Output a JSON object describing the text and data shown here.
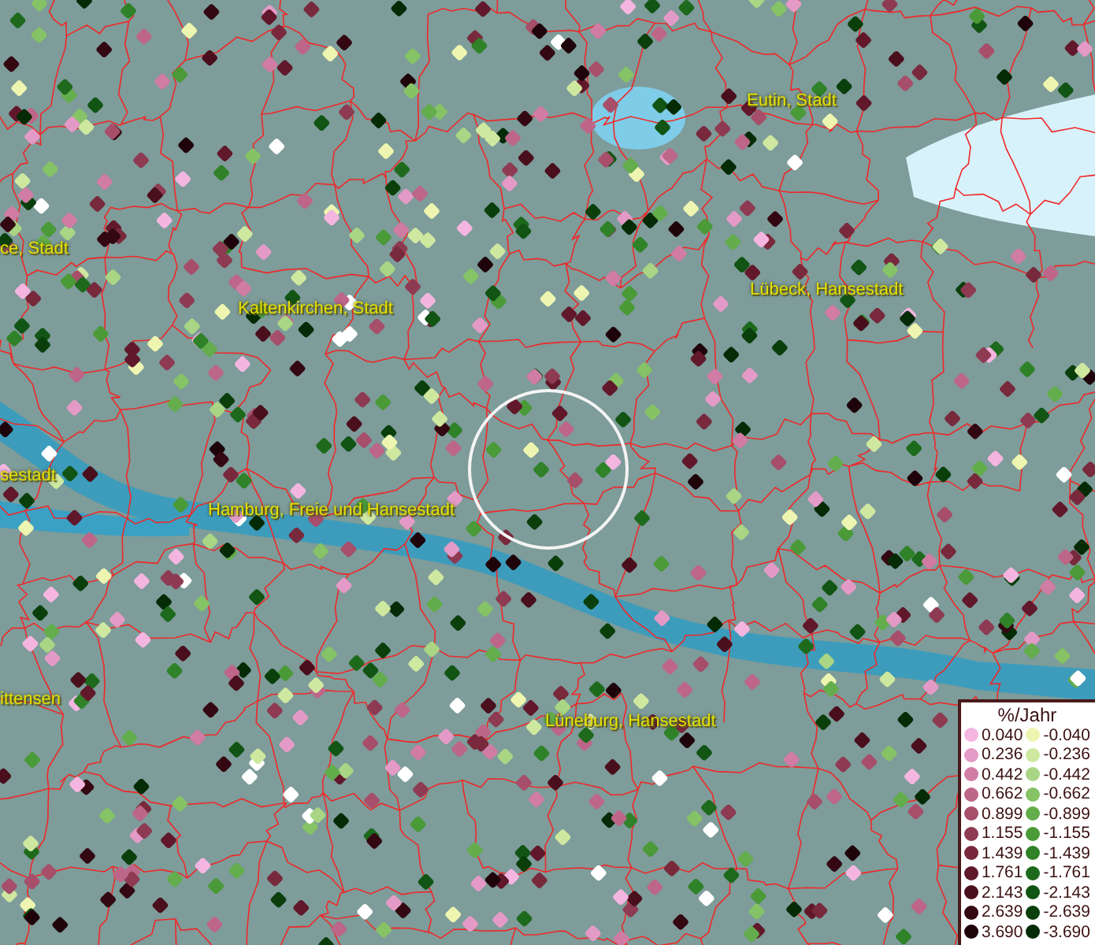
{
  "map": {
    "place_labels": [
      {
        "text": "Eutin, Stadt"
      },
      {
        "text": "ce, Stadt"
      },
      {
        "text": "Lübeck, Hansestadt"
      },
      {
        "text": "Kaltenkirchen, Stadt"
      },
      {
        "text": "sestadt"
      },
      {
        "text": "Hamburg, Freie und Hansestadt"
      },
      {
        "text": "ittensen"
      },
      {
        "text": "Lüneburg, Hansestadt"
      }
    ]
  },
  "legend": {
    "title": "%/Jahr",
    "positive": [
      {
        "label": "0.040",
        "color": "#f4b6e0"
      },
      {
        "label": "0.236",
        "color": "#e39ac6"
      },
      {
        "label": "0.442",
        "color": "#d07ca4"
      },
      {
        "label": "0.662",
        "color": "#bd6688"
      },
      {
        "label": "0.899",
        "color": "#a64e6a"
      },
      {
        "label": "1.155",
        "color": "#8e3a52"
      },
      {
        "label": "1.439",
        "color": "#78293c"
      },
      {
        "label": "1.761",
        "color": "#61182a"
      },
      {
        "label": "2.143",
        "color": "#4a0f1c"
      },
      {
        "label": "2.639",
        "color": "#330812"
      },
      {
        "label": "3.690",
        "color": "#1e040a"
      }
    ],
    "negative": [
      {
        "label": "-0.040",
        "color": "#eef5b0"
      },
      {
        "label": "-0.236",
        "color": "#cfe8a0"
      },
      {
        "label": "-0.442",
        "color": "#a9d585"
      },
      {
        "label": "-0.662",
        "color": "#86c266"
      },
      {
        "label": "-0.899",
        "color": "#63ad4c"
      },
      {
        "label": "-1.155",
        "color": "#4a9a38"
      },
      {
        "label": "-1.439",
        "color": "#2f8228"
      },
      {
        "label": "-1.761",
        "color": "#1e6a1c"
      },
      {
        "label": "-2.143",
        "color": "#115414"
      },
      {
        "label": "-2.639",
        "color": "#0a3f0c"
      },
      {
        "label": "-3.690",
        "color": "#052a06"
      }
    ]
  }
}
